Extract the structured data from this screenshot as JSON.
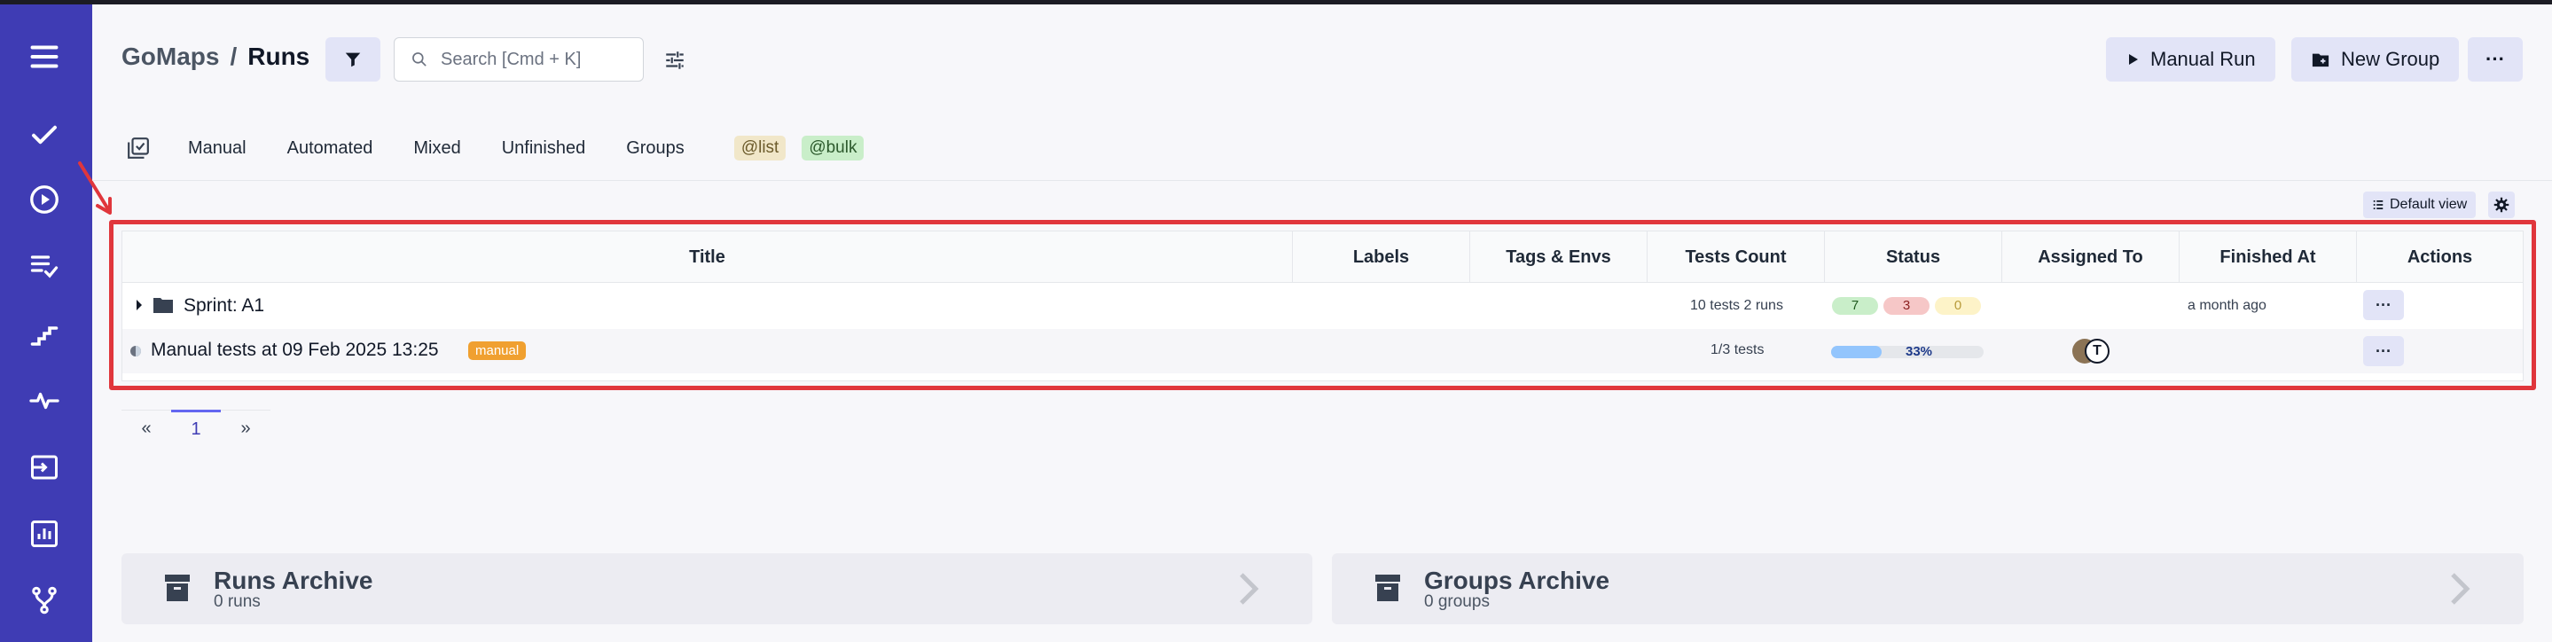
{
  "breadcrumb": {
    "project": "GoMaps",
    "separator": "/",
    "current": "Runs"
  },
  "search": {
    "placeholder": "Search [Cmd + K]"
  },
  "header_buttons": {
    "manual_run": "Manual Run",
    "new_group": "New Group",
    "more": "···"
  },
  "tabs": [
    "Manual",
    "Automated",
    "Mixed",
    "Unfinished",
    "Groups"
  ],
  "tags": [
    {
      "label": "@list",
      "bg": "#f1e7c9",
      "color": "#6b5a2a"
    },
    {
      "label": "@bulk",
      "bg": "#c9eec9",
      "color": "#2d5a2d"
    }
  ],
  "view": {
    "default_view": "Default view"
  },
  "table": {
    "columns": [
      "Title",
      "Labels",
      "Tags & Envs",
      "Tests Count",
      "Status",
      "Assigned To",
      "Finished At",
      "Actions"
    ],
    "rows": [
      {
        "title": "Sprint: A1",
        "type": "group",
        "tests_count": "10 tests 2 runs",
        "status": {
          "passed": "7",
          "failed": "3",
          "skipped": "0"
        },
        "finished_at": "a month ago",
        "action": "···"
      },
      {
        "title": "Manual tests at 09 Feb 2025 13:25",
        "badge": "manual",
        "type": "run",
        "tests_count": "1/3 tests",
        "progress": {
          "percent": 33,
          "label": "33%"
        },
        "assignees": [
          "T"
        ],
        "action": "···"
      }
    ]
  },
  "pagination": {
    "prev": "«",
    "current": "1",
    "next": "»"
  },
  "archives": [
    {
      "title": "Runs Archive",
      "subtitle": "0 runs"
    },
    {
      "title": "Groups Archive",
      "subtitle": "0 groups"
    }
  ],
  "colors": {
    "sidebar": "#3f3cb4",
    "accent": "#e2e4f7",
    "highlight": "#e0363c",
    "badge_manual": "#f0a030"
  }
}
